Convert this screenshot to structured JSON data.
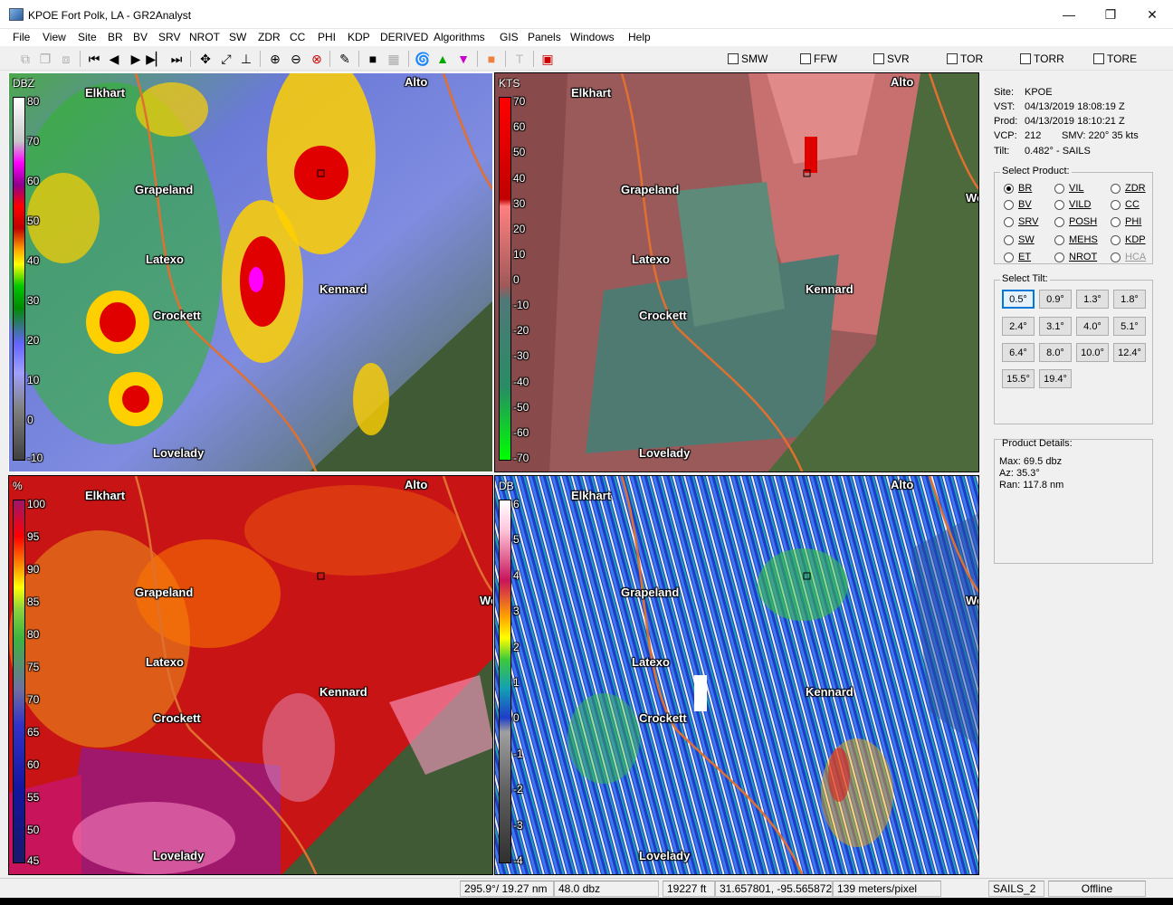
{
  "window": {
    "title": "KPOE Fort Polk, LA - GR2Analyst",
    "min": "—",
    "max": "❐",
    "close": "✕"
  },
  "menu": [
    "File",
    "View",
    "Site",
    "BR",
    "BV",
    "SRV",
    "NROT",
    "SW",
    "ZDR",
    "CC",
    "PHI",
    "KDP",
    "DERIVED",
    "Algorithms",
    "GIS",
    "Panels",
    "Windows",
    "Help"
  ],
  "warnings": [
    "SMW",
    "FFW",
    "SVR",
    "TOR",
    "TORR",
    "TORE"
  ],
  "panels": {
    "br": {
      "unit": "DBZ",
      "ticks": [
        "80",
        "70",
        "60",
        "50",
        "40",
        "30",
        "20",
        "10",
        "0",
        "-10"
      ]
    },
    "bv": {
      "unit": "KTS",
      "ticks": [
        "70",
        "60",
        "50",
        "40",
        "30",
        "20",
        "10",
        "0",
        "-10",
        "-20",
        "-30",
        "-40",
        "-50",
        "-60",
        "-70"
      ]
    },
    "cc": {
      "unit": "%",
      "ticks": [
        "100",
        "95",
        "90",
        "85",
        "80",
        "75",
        "70",
        "65",
        "60",
        "55",
        "50",
        "45"
      ]
    },
    "zdr": {
      "unit": "DB",
      "ticks": [
        "6",
        "5",
        "4",
        "3",
        "2",
        "1",
        "0",
        "-1",
        "-2",
        "-3",
        "-4"
      ]
    }
  },
  "cities": [
    "Elkhart",
    "Alto",
    "Grapeland",
    "Latexo",
    "Kennard",
    "Crockett",
    "Lovelady",
    "Wo"
  ],
  "site_info": {
    "site": {
      "label": "Site:",
      "value": "KPOE"
    },
    "vst": {
      "label": "VST:",
      "value": "04/13/2019  18:08:19 Z"
    },
    "prod": {
      "label": "Prod:",
      "value": "04/13/2019  18:10:21 Z"
    },
    "vcp": {
      "label": "VCP:",
      "value": "212"
    },
    "smv": "SMV:  220° 35 kts",
    "tilt": {
      "label": "Tilt:",
      "value": "0.482° - SAILS"
    }
  },
  "select_product": {
    "title": "Select Product:",
    "options": [
      {
        "label": "BR",
        "checked": true
      },
      {
        "label": "VIL"
      },
      {
        "label": "ZDR"
      },
      {
        "label": "BV"
      },
      {
        "label": "VILD"
      },
      {
        "label": "CC"
      },
      {
        "label": "SRV"
      },
      {
        "label": "POSH"
      },
      {
        "label": "PHI"
      },
      {
        "label": "SW"
      },
      {
        "label": "MEHS"
      },
      {
        "label": "KDP"
      },
      {
        "label": "ET"
      },
      {
        "label": "NROT"
      },
      {
        "label": "HCA",
        "disabled": true
      }
    ]
  },
  "select_tilt": {
    "title": "Select Tilt:",
    "tilts": [
      "0.5°",
      "0.9°",
      "1.3°",
      "1.8°",
      "2.4°",
      "3.1°",
      "4.0°",
      "5.1°",
      "6.4°",
      "8.0°",
      "10.0°",
      "12.4°",
      "15.5°",
      "19.4°"
    ]
  },
  "product_details": {
    "title": "Product Details:",
    "max": "Max:  69.5 dbz",
    "az": "Az:  35.3°",
    "ran": "Ran:  117.8 nm"
  },
  "status": {
    "azran": "295.9°/ 19.27 nm",
    "value": "48.0 dbz",
    "height": "19227 ft",
    "latlon": "31.657801, -95.565872",
    "res": "139 meters/pixel",
    "mode": "SAILS_2",
    "conn": "Offline"
  },
  "colors": {
    "br_scale": [
      "#ffffff",
      "#c8c8c8",
      "#ff00ff",
      "#a000a0",
      "#ff0000",
      "#c80000",
      "#ffa500",
      "#ffff00",
      "#00c800",
      "#009600",
      "#6464ff",
      "#a0a0ff",
      "#808080",
      "#404040"
    ],
    "bv_scale": [
      "#ff0000",
      "#c80000",
      "#ff7878",
      "#a05050",
      "#507878",
      "#288c64",
      "#00ff00"
    ]
  }
}
